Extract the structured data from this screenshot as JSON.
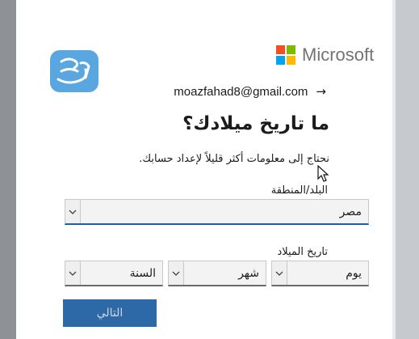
{
  "watermark": {
    "text": "المرجع"
  },
  "brand": {
    "name": "Microsoft"
  },
  "identity": {
    "email": "moazfahad8@gmail.com",
    "arrow_icon": "arrow-right-icon"
  },
  "page": {
    "title": "ما تاريخ ميلادك؟",
    "description": "نحتاج إلى معلومات أكثر قليلاً لإعداد حسابك."
  },
  "country": {
    "label": "البلد/المنطقة",
    "value": "مصر"
  },
  "birthdate": {
    "label": "تاريخ الميلاد",
    "day": "يوم",
    "month": "شهر",
    "year": "السنة"
  },
  "actions": {
    "next": "التالي"
  },
  "colors": {
    "ms_red": "#f25022",
    "ms_green": "#7fba00",
    "ms_blue": "#00a4ef",
    "ms_yellow": "#ffb900",
    "button": "#2d69a6",
    "focus_underline": "#1e5fa8"
  }
}
